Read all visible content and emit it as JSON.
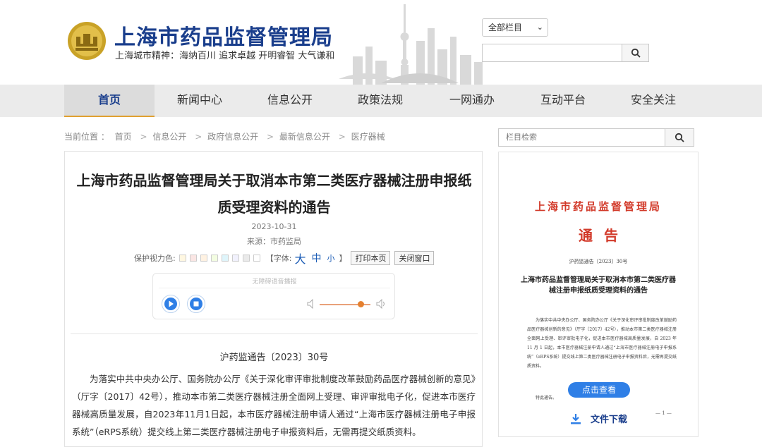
{
  "header": {
    "site_title": "上海市药品监督管理局",
    "slogan": "上海城市精神：海纳百川  追求卓越  开明睿智  大气谦和",
    "channel_select": "全部栏目",
    "search_placeholder": ""
  },
  "nav": {
    "items": [
      {
        "label": "首页"
      },
      {
        "label": "新闻中心"
      },
      {
        "label": "信息公开"
      },
      {
        "label": "政策法规"
      },
      {
        "label": "一网通办"
      },
      {
        "label": "互动平台"
      },
      {
        "label": "安全关注"
      }
    ]
  },
  "breadcrumb": {
    "prefix": "当前位置 ：",
    "items": [
      "首页",
      "信息公开",
      "政府信息公开",
      "最新信息公开",
      "医疗器械"
    ]
  },
  "article": {
    "title": "上海市药品监督管理局关于取消本市第二类医疗器械注册申报纸质受理资料的通告",
    "date": "2023-10-31",
    "source": "来源：市药监局",
    "vision_label": "保护视力色:",
    "font_label": "【字体:",
    "font_big": "大",
    "font_mid": "中",
    "font_small": "小",
    "font_close": "】",
    "print_btn": "打印本页",
    "close_btn": "关闭窗口",
    "player_hint": "无障碍语音播报",
    "doc_no": "沪药监通告〔2023〕30号",
    "body": "为落实中共中央办公厅、国务院办公厅《关于深化审评审批制度改革鼓励药品医疗器械创新的意见》（厅字〔2017〕42号），推动本市第二类医疗器械注册全面网上受理、审评审批电子化，促进本市医疗器械高质量发展，自2023年11月1日起，本市医疗器械注册申请人通过“上海市医疗器械注册电子申报系统”（eRPS系统）提交线上第二类医疗器械注册电子申报资料后，无需再提交纸质资料。"
  },
  "sidebar": {
    "search_placeholder": "栏目检索",
    "notice": {
      "org": "上海市药品监督管理局",
      "title": "通告",
      "doc_no": "沪药监通告〔2023〕30号",
      "head": "上海市药品监督管理局关于取消本市第二类医疗器械注册申报纸质受理资料的通告",
      "body": "为落实中共中央办公厅、国务院办公厅《关于深化审评审批制度改革鼓励药品医疗器械创新的意见》（厅字〔2017〕42号），推动本市第二类医疗器械注册全面网上受理、审评审批电子化，促进本市医疗器械高质量发展，自 2023 年 11 月 1 日起，本市医疗器械注册申请人通过“上海市医疗器械注册电子申报系统”（eRPS系统）提交线上第二类医疗器械注册电子申报资料后，无需再提交纸质资料。",
      "body2": "特此通告。",
      "page": "— 1 —",
      "view_btn": "点击查看",
      "download": "文件下载"
    }
  },
  "colors": {
    "brand_blue": "#1a3e8c",
    "notice_red": "#d23a2a",
    "button_blue": "#2f7fe6",
    "nav_accent": "#e0a030"
  }
}
